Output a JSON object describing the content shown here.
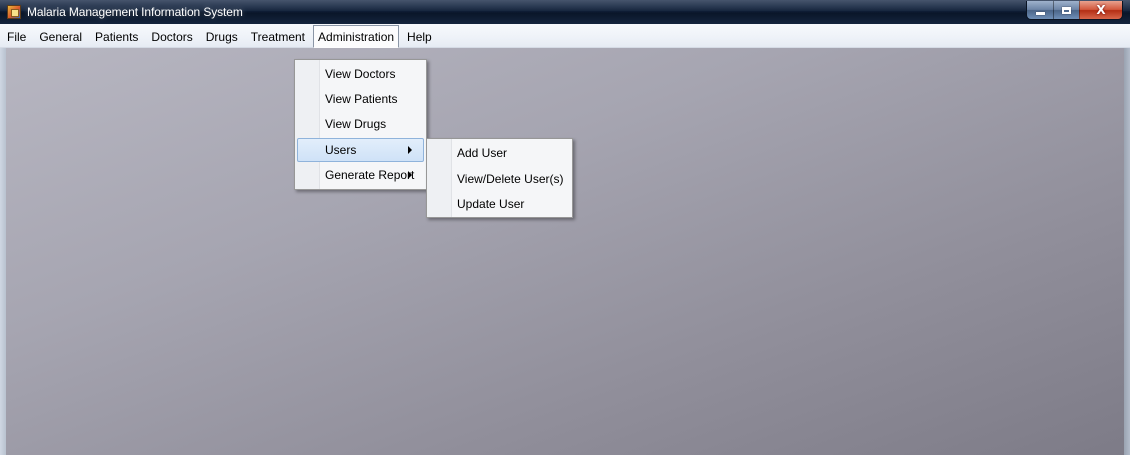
{
  "window": {
    "title": "Malaria Management Information System",
    "icon": "app-icon",
    "caption_icons": [
      "minimize-icon",
      "maximize-icon",
      "close-icon"
    ],
    "close_glyph": "X"
  },
  "menubar": {
    "items": [
      {
        "label": "File"
      },
      {
        "label": "General"
      },
      {
        "label": "Patients"
      },
      {
        "label": "Doctors"
      },
      {
        "label": "Drugs"
      },
      {
        "label": "Treatment"
      },
      {
        "label": "Administration",
        "open": true
      },
      {
        "label": "Help"
      }
    ]
  },
  "administration_menu": {
    "items": [
      {
        "label": "View Doctors"
      },
      {
        "label": "View Patients"
      },
      {
        "label": "View Drugs"
      },
      {
        "label": "Users",
        "submenu": true,
        "highlighted": true
      },
      {
        "label": "Generate Report",
        "submenu": true
      }
    ]
  },
  "users_submenu": {
    "items": [
      {
        "label": "Add User"
      },
      {
        "label": "View/Delete User(s)"
      },
      {
        "label": "Update User"
      }
    ]
  },
  "colors": {
    "highlight": "#cfe2f7",
    "highlight_border": "#8fb3db",
    "titlebar": "#0f1f38",
    "close_button": "#d2573c"
  }
}
